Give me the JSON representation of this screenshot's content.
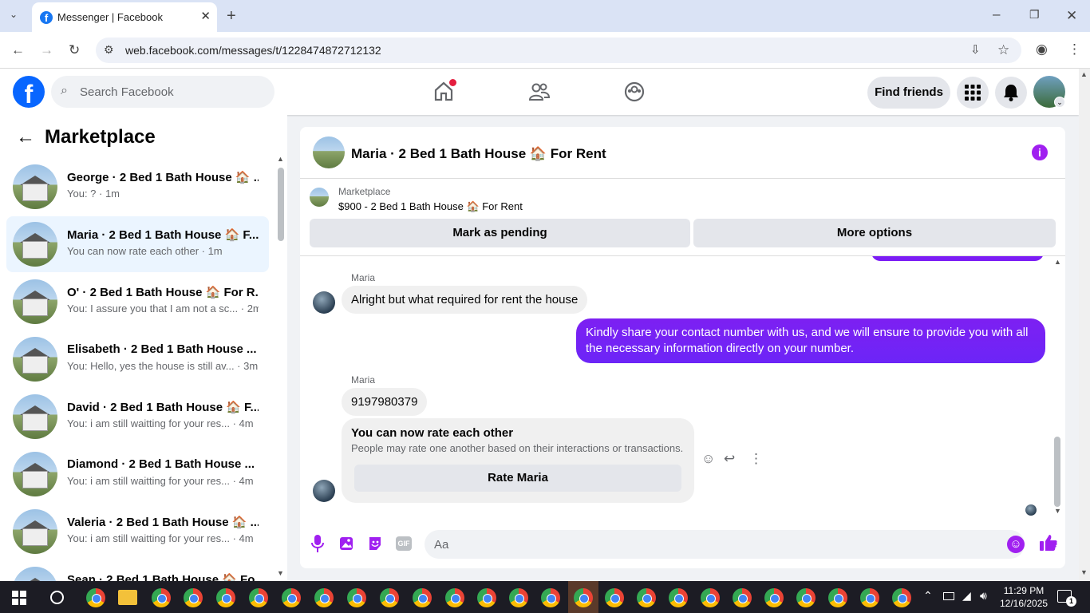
{
  "browser": {
    "tab_title": "Messenger | Facebook",
    "url": "web.facebook.com/messages/t/1228474872712132"
  },
  "header": {
    "search_placeholder": "Search Facebook",
    "find_friends": "Find friends"
  },
  "sidebar": {
    "title": "Marketplace",
    "conversations": [
      {
        "name": "George · 2 Bed 1 Bath House 🏠 ...",
        "preview": "You: ? · 1m"
      },
      {
        "name": "Maria · 2 Bed 1 Bath House 🏠 F...",
        "preview": "You can now rate each other · 1m"
      },
      {
        "name": "O' · 2 Bed 1 Bath House 🏠 For R...",
        "preview": "You: I assure you that I am not a sc... · 2m"
      },
      {
        "name": "Elisabeth · 2 Bed 1 Bath House ...",
        "preview": "You: Hello, yes the house is still av... · 3m"
      },
      {
        "name": "David · 2 Bed 1 Bath House 🏠 F...",
        "preview": "You: i am still waitting for your res... · 4m"
      },
      {
        "name": "Diamond · 2 Bed 1 Bath House ...",
        "preview": "You: i am still waitting for your res... · 4m"
      },
      {
        "name": "Valeria · 2 Bed 1 Bath House 🏠 ...",
        "preview": "You: i am still waitting for your res... · 4m"
      },
      {
        "name": "Sean · 2 Bed 1 Bath House 🏠 Fo...",
        "preview": ""
      }
    ]
  },
  "chat": {
    "title": "Maria · 2 Bed 1 Bath House 🏠 For Rent",
    "marketplace_label": "Marketplace",
    "listing": "$900 - 2 Bed 1 Bath House 🏠 For Rent",
    "mark_pending": "Mark as pending",
    "more_options": "More options",
    "messages": [
      {
        "sender": "Maria",
        "text": "Alright but what required for rent the house"
      },
      {
        "text": "Kindly share your contact number with us, and we will ensure to provide you with all the necessary information directly on your number."
      },
      {
        "sender": "Maria",
        "text": "9197980379"
      }
    ],
    "rate_card": {
      "title": "You can now rate each other",
      "description": "People may rate one another based on their interactions or transactions.",
      "button": "Rate Maria"
    },
    "input_placeholder": "Aa"
  },
  "taskbar": {
    "time": "11:29 PM",
    "date": "12/16/2025",
    "notification_count": "1"
  },
  "colors": {
    "accent": "#0866ff",
    "bubble_out": "#7b1cf5",
    "selected_row": "#ebf5ff"
  }
}
